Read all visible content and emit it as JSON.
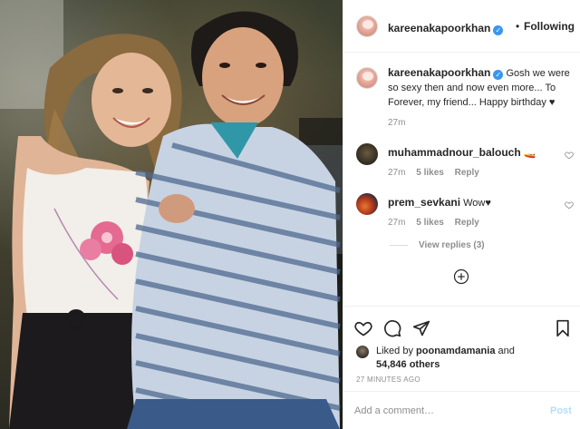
{
  "post": {
    "author": "kareenakapoorkhan",
    "follow_dot": "•",
    "follow_label": "Following",
    "caption": "Gosh we were so sexy then and now even more... To Forever, my friend... Happy birthday ♥",
    "caption_time": "27m"
  },
  "comments": [
    {
      "user": "muhammadnour_balouch",
      "text": "🚤",
      "time": "27m",
      "likes": "5 likes",
      "reply": "Reply"
    },
    {
      "user": "prem_sevkani",
      "text": "Wow♥",
      "time": "27m",
      "likes": "5 likes",
      "reply": "Reply"
    }
  ],
  "view_replies": "View replies (3)",
  "likes": {
    "prefix": "Liked by ",
    "user": "poonamdamania",
    "middle": " and",
    "count": "54,846 others"
  },
  "timestamp": "27 MINUTES AGO",
  "add_comment": {
    "placeholder": "Add a comment…",
    "post_label": "Post"
  },
  "icons": {
    "verified": "verified-badge-icon",
    "heart": "heart-icon",
    "comment": "comment-icon",
    "share": "share-icon",
    "save": "bookmark-icon",
    "load_more": "plus-circle-icon"
  },
  "colors": {
    "verified_blue": "#3897f0",
    "post_disabled": "#b2dffc",
    "meta_gray": "#8e8e8e"
  }
}
